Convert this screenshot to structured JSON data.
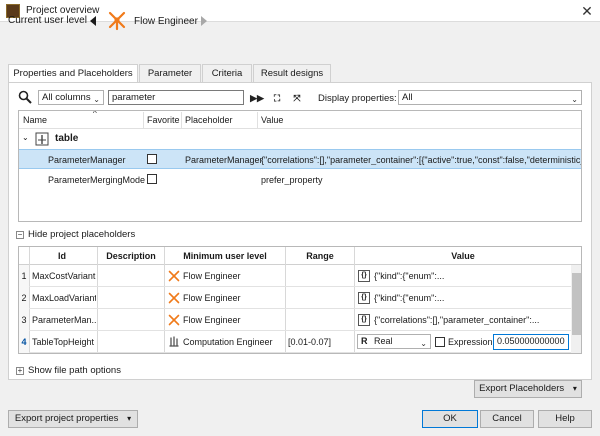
{
  "window": {
    "title": "Project overview",
    "close_glyph": "✕"
  },
  "level": {
    "label": "Current user level",
    "name": "Flow Engineer",
    "icon": "flow-engineer-icon"
  },
  "tabs": [
    {
      "label": "Properties and Placeholders",
      "active": true
    },
    {
      "label": "Parameter"
    },
    {
      "label": "Criteria"
    },
    {
      "label": "Result designs"
    }
  ],
  "search": {
    "scope": "All columns",
    "query": "parameter",
    "display_label": "Display properties:",
    "display_value": "All",
    "btn_next": "▶▶",
    "btn_expand": "⛶",
    "btn_collapse": "⤧"
  },
  "tree": {
    "columns": [
      "Name",
      "Favorite",
      "Placeholder",
      "Value"
    ],
    "group": {
      "label": "table"
    },
    "rows": [
      {
        "name": "ParameterManager",
        "placeholder": "ParameterManager",
        "value": "{\"correlations\":[],\"parameter_container\":[{\"active\":true,\"const\":false,\"deterministic_p...",
        "selected": true
      },
      {
        "name": "ParameterMergingMode",
        "placeholder": "",
        "value": "prefer_property",
        "selected": false
      }
    ]
  },
  "placeholders": {
    "toggle_label": "Hide project placeholders",
    "columns": [
      "Id",
      "Description",
      "Minimum user level",
      "Range",
      "Value"
    ],
    "rows": [
      {
        "num": "1",
        "id": "MaxCostVariant",
        "description": "",
        "level": "Flow Engineer",
        "range": "",
        "value": "{\"kind\":{\"enum\":..."
      },
      {
        "num": "2",
        "id": "MaxLoadVariant",
        "description": "",
        "level": "Flow Engineer",
        "range": "",
        "value": "{\"kind\":{\"enum\":..."
      },
      {
        "num": "3",
        "id": "ParameterMan...",
        "description": "",
        "level": "Flow Engineer",
        "range": "",
        "value": "{\"correlations\":[],\"parameter_container\":..."
      },
      {
        "num": "4",
        "id": "TableTopHeight",
        "description": "",
        "level": "Computation Engineer",
        "range": "[0.01-0.07]",
        "type_badge": "R",
        "type": "Real",
        "expression_label": "Expression",
        "number": "0.050000000000"
      }
    ]
  },
  "file_path": {
    "label": "Show file path options"
  },
  "buttons": {
    "export_placeholders": "Export Placeholders",
    "export_project": "Export project properties",
    "ok": "OK",
    "cancel": "Cancel",
    "help": "Help"
  },
  "colors": {
    "accent_orange": "#f07a1a",
    "selection": "#cce4f7"
  }
}
